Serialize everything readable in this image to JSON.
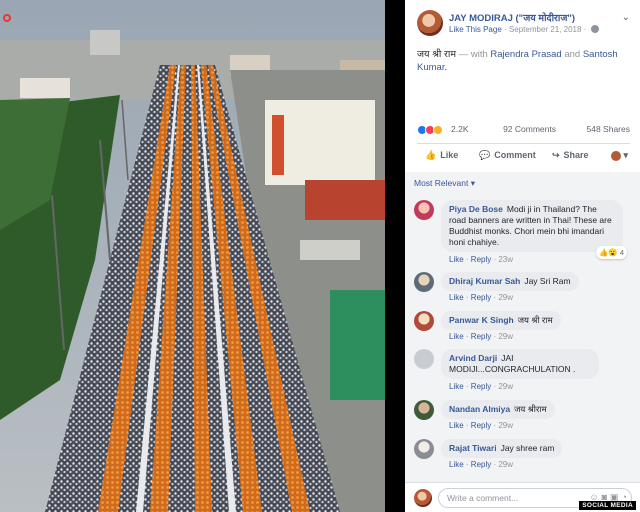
{
  "post": {
    "author": "JAY MODIRAJ (\"जय मोदीराज\")",
    "like_page": "Like This Page",
    "date": "September 21, 2018",
    "dot": "·",
    "options": "⌄",
    "text": "जय श्री राम",
    "with_text": "— with",
    "tag1": "Rajendra Prasad",
    "and_text": "and",
    "tag2": "Santosh Kumar",
    "tag2_suffix": "."
  },
  "stats": {
    "reactions": "2.2K",
    "comments": "92 Comments",
    "shares": "548 Shares"
  },
  "actions": {
    "like": "Like",
    "comment": "Comment",
    "share": "Share",
    "like_icon": "👍",
    "comment_icon": "💬",
    "share_icon": "↪"
  },
  "sort_label": "Most Relevant ▾",
  "comments": [
    {
      "name": "Piya De Bose",
      "text": "Modi ji in Thailand? The road banners are written in Thai! These are Buddhist monks. Chori mein bhi imandari honi chahiye.",
      "like": "Like",
      "reply": "Reply",
      "time": "23w",
      "reactions": "4"
    },
    {
      "name": "Dhiraj Kumar Sah",
      "text": "Jay Sri Ram",
      "like": "Like",
      "reply": "Reply",
      "time": "29w"
    },
    {
      "name": "Panwar K Singh",
      "text": "जय श्री राम",
      "like": "Like",
      "reply": "Reply",
      "time": "29w"
    },
    {
      "name": "Arvind Darji",
      "text": "JAI MODIJI...CONGRACHULATION .",
      "like": "Like",
      "reply": "Reply",
      "time": "29w"
    },
    {
      "name": "Nandan Almiya",
      "text": "जय श्रीराम",
      "like": "Like",
      "reply": "Reply",
      "time": "29w"
    },
    {
      "name": "Rajat Tiwari",
      "text": "Jay shree ram",
      "like": "Like",
      "reply": "Reply",
      "time": "29w"
    }
  ],
  "write_placeholder": "Write a comment...",
  "watermark": "SOCIAL MEDIA",
  "colors": {
    "link": "#385898",
    "muted": "#90949c",
    "bubble": "#e9ebee",
    "monk_orange": "#e8842a"
  }
}
